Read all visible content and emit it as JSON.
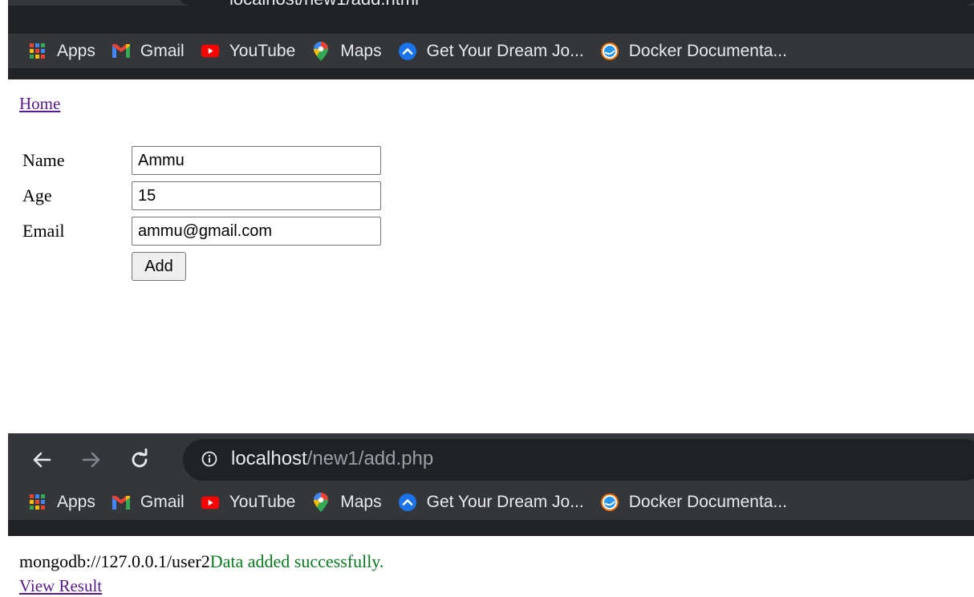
{
  "browser_top": {
    "cut_address_text": "localhost/new1/add.html",
    "bookmarks": [
      {
        "label": "Apps",
        "icon": "apps-grid-icon"
      },
      {
        "label": "Gmail",
        "icon": "gmail-icon"
      },
      {
        "label": "YouTube",
        "icon": "youtube-icon"
      },
      {
        "label": "Maps",
        "icon": "maps-icon"
      },
      {
        "label": "Get Your Dream Jo...",
        "icon": "chevron-up-circle-icon"
      },
      {
        "label": "Docker Documenta...",
        "icon": "docker-icon"
      }
    ]
  },
  "form_page": {
    "home_link": "Home",
    "fields": [
      {
        "label": "Name",
        "value": "Ammu"
      },
      {
        "label": "Age",
        "value": "15"
      },
      {
        "label": "Email",
        "value": "ammu@gmail.com"
      }
    ],
    "add_button": "Add"
  },
  "browser_bottom": {
    "url_host": "localhost",
    "url_path": "/new1/add.php",
    "bookmarks": [
      {
        "label": "Apps",
        "icon": "apps-grid-icon"
      },
      {
        "label": "Gmail",
        "icon": "gmail-icon"
      },
      {
        "label": "YouTube",
        "icon": "youtube-icon"
      },
      {
        "label": "Maps",
        "icon": "maps-icon"
      },
      {
        "label": "Get Your Dream Jo...",
        "icon": "chevron-up-circle-icon"
      },
      {
        "label": "Docker Documenta...",
        "icon": "docker-icon"
      }
    ]
  },
  "result_page": {
    "connection_text": "mongodb://127.0.0.1/user2",
    "success_text": "Data added successfully.",
    "view_link": "View Result"
  },
  "colors": {
    "success": "#0a7a1f",
    "visited_link": "#551a8b",
    "chrome_dark": "#202124",
    "chrome_toolbar": "#35363a"
  }
}
